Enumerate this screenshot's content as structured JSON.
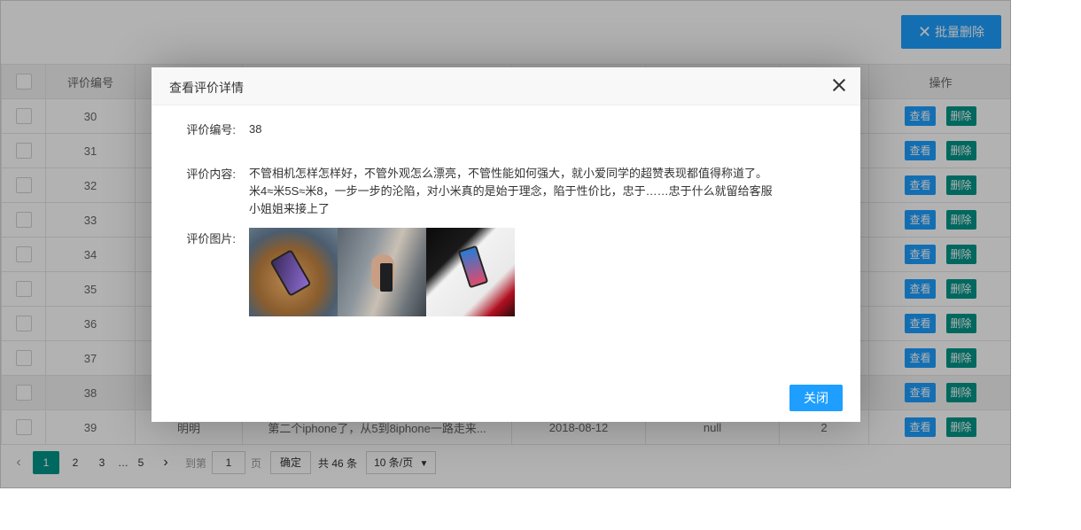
{
  "toolbar": {
    "batch_delete_label": "批量删除"
  },
  "table": {
    "headers": [
      "评价编号",
      "",
      "",
      "",
      "",
      "",
      "操作"
    ],
    "rows": [
      {
        "id": "30",
        "user": "",
        "content": "",
        "date": "",
        "reply": "",
        "count": ""
      },
      {
        "id": "31",
        "user": "",
        "content": "",
        "date": "",
        "reply": "",
        "count": ""
      },
      {
        "id": "32",
        "user": "",
        "content": "",
        "date": "",
        "reply": "",
        "count": ""
      },
      {
        "id": "33",
        "user": "",
        "content": "",
        "date": "",
        "reply": "",
        "count": ""
      },
      {
        "id": "34",
        "user": "",
        "content": "",
        "date": "",
        "reply": "",
        "count": ""
      },
      {
        "id": "35",
        "user": "",
        "content": "",
        "date": "",
        "reply": "",
        "count": ""
      },
      {
        "id": "36",
        "user": "",
        "content": "",
        "date": "",
        "reply": "",
        "count": ""
      },
      {
        "id": "37",
        "user": "",
        "content": "",
        "date": "",
        "reply": "",
        "count": ""
      },
      {
        "id": "38",
        "user": "",
        "content": "",
        "date": "",
        "reply": "",
        "count": ""
      },
      {
        "id": "39",
        "user": "明明",
        "content": "第二个iphone了，从5到8iphone一路走来...",
        "date": "2018-08-12",
        "reply": "null",
        "count": "2"
      }
    ],
    "view_label": "查看",
    "delete_label": "删除"
  },
  "pager": {
    "pages": [
      "1",
      "2",
      "3",
      "…",
      "5"
    ],
    "goto_label": "到第",
    "page_input": "1",
    "page_unit": "页",
    "confirm_label": "确定",
    "total_label": "共 46 条",
    "page_size_label": "10 条/页"
  },
  "modal": {
    "title": "查看评价详情",
    "id_label": "评价编号:",
    "id_value": "38",
    "content_label": "评价内容:",
    "content_value": "不管相机怎样怎样好，不管外观怎么漂亮，不管性能如何强大，就小爱同学的超赞表现都值得称道了。米4≈米5S≈米8，一步一步的沦陷，对小米真的是始于理念，陷于性价比，忠于……忠于什么就留给客服小姐姐来接上了",
    "images_label": "评价图片:",
    "close_label": "关闭"
  },
  "colors": {
    "primary": "#1e9fff",
    "teal": "#009688"
  }
}
